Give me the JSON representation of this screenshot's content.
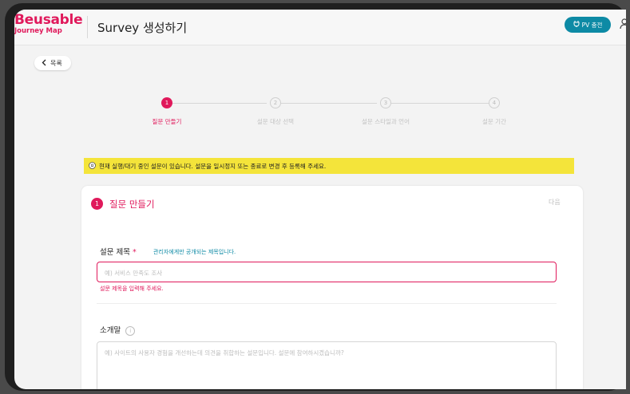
{
  "brand": {
    "logo_main": "Beusable",
    "logo_sub": "Journey Map",
    "color": "#e0195b"
  },
  "header": {
    "title": "Survey 생성하기",
    "pv_button": "PV 충전",
    "pv_color": "#0d8aa5"
  },
  "nav": {
    "back_label": "목록"
  },
  "steps": [
    {
      "num": "1",
      "label": "질문 만들기",
      "active": true
    },
    {
      "num": "2",
      "label": "설문 대상 선택",
      "active": false
    },
    {
      "num": "3",
      "label": "설문 스타일과 언어",
      "active": false
    },
    {
      "num": "4",
      "label": "설문 기간",
      "active": false
    }
  ],
  "notice": {
    "text": "현재 실행/대기 중인 설문이 있습니다. 설문을 일시정지 또는 종료로 변경 후 등록해 주세요."
  },
  "card": {
    "number": "1",
    "title": "질문 만들기",
    "next_label": "다음",
    "survey_title": {
      "label": "설문 제목",
      "required_mark": "*",
      "hint": "관리자에게만 공개되는 제목입니다.",
      "placeholder": "예) 서비스 만족도 조사",
      "error": "설문 제목을 입력해 주세요."
    },
    "intro": {
      "label": "소개말",
      "info": "i",
      "placeholder": "예) 사이트의 사용자 경험을 개선하는데 의견을 취합하는 설문입니다. 설문에 참여하시겠습니까?"
    }
  }
}
